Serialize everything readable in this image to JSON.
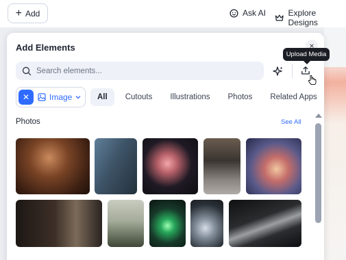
{
  "topbar": {
    "add_label": "Add",
    "ask_ai_label": "Ask AI",
    "explore_label": "Explore Designs"
  },
  "panel": {
    "title": "Add Elements",
    "search_placeholder": "Search elements...",
    "tooltip": "Upload Media",
    "filter_chip_label": "Image",
    "tabs": [
      {
        "label": "All",
        "active": true
      },
      {
        "label": "Cutouts",
        "active": false
      },
      {
        "label": "Illustrations",
        "active": false
      },
      {
        "label": "Photos",
        "active": false
      },
      {
        "label": "Related Apps",
        "active": false
      }
    ],
    "section_title": "Photos",
    "see_all": "See All"
  },
  "colors": {
    "accent": "#2f6bff",
    "panel_bg": "#ffffff",
    "search_bg": "#eef1f7",
    "tooltip_bg": "#1a1d24"
  },
  "icons": {
    "add": "plus-icon",
    "ask_ai": "smiley-icon",
    "explore": "crown-icon",
    "search": "search-icon",
    "sparkle": "sparkle-icon",
    "upload": "upload-icon",
    "close": "close-icon"
  },
  "photos": [
    {
      "name": "mushroom-gills-photo"
    },
    {
      "name": "man-with-phone-photo"
    },
    {
      "name": "pink-flower-photo"
    },
    {
      "name": "teacup-photo"
    },
    {
      "name": "cloudy-sky-photo"
    },
    {
      "name": "piano-player-photo"
    },
    {
      "name": "silhouette-landscape-photo"
    },
    {
      "name": "green-sparkle-orb-photo"
    },
    {
      "name": "glass-hand-photo"
    },
    {
      "name": "phone-closeup-photo"
    }
  ]
}
